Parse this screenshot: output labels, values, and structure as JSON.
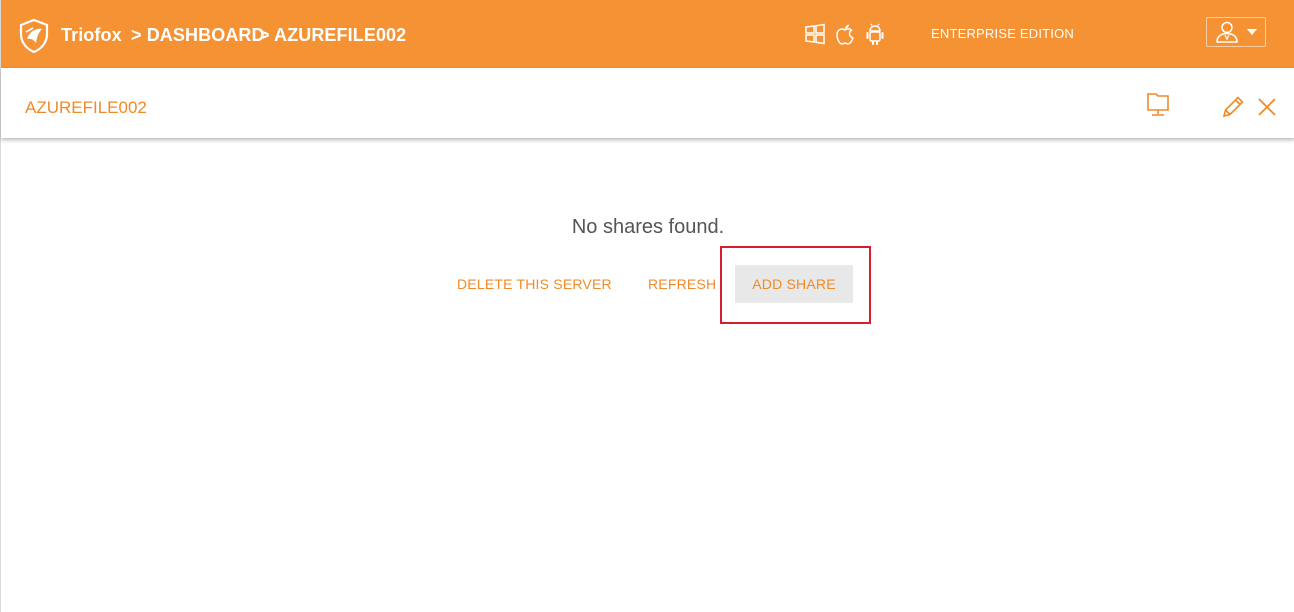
{
  "header": {
    "brand": "Triofox",
    "breadcrumb": [
      "> DASHBOARD",
      "> AZUREFILE002"
    ],
    "edition": "ENTERPRISE EDITION",
    "platform_icons": [
      "windows-icon",
      "apple-icon",
      "android-icon"
    ],
    "user_icon": "user-icon"
  },
  "panel": {
    "title": "AZUREFILE002",
    "icons": [
      "monitor-icon",
      "edit-pencil-icon",
      "close-icon"
    ]
  },
  "content": {
    "empty_message": "No shares found.",
    "actions": {
      "delete": "DELETE THIS SERVER",
      "refresh": "REFRESH",
      "add_share": "ADD SHARE"
    }
  },
  "colors": {
    "accent": "#f59234",
    "accent_text": "#f08a27",
    "highlight": "#d81e2c"
  }
}
